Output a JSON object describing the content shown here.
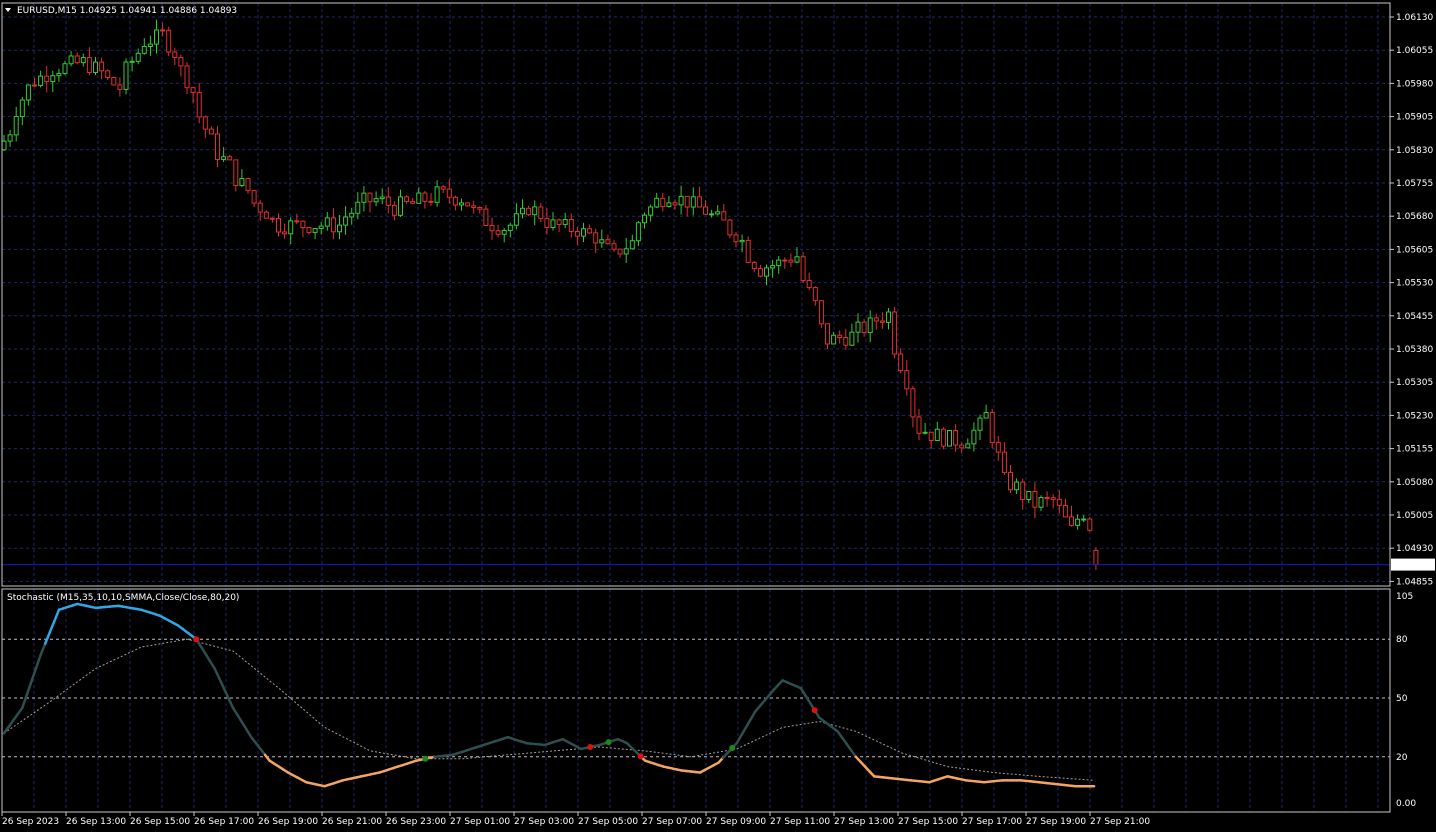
{
  "header": {
    "symbol_line": "EURUSD,M15  1.04925 1.04941 1.04886 1.04893",
    "dropdown_icon": "triangle-down-icon"
  },
  "indicator": {
    "label": "Stochastic (M15,35,10,10,SMMA,Close/Close,80,20)",
    "levels": [
      "80",
      "50",
      "20"
    ],
    "top_label": "105",
    "bottom_label": "0.00"
  },
  "price_axis": {
    "labels": [
      "1.06130",
      "1.06055",
      "1.05980",
      "1.05905",
      "1.05830",
      "1.05755",
      "1.05680",
      "1.05605",
      "1.05530",
      "1.05455",
      "1.05380",
      "1.05305",
      "1.05230",
      "1.05155",
      "1.05080",
      "1.05005",
      "1.04930",
      "1.04855"
    ],
    "current_price": "1.04893"
  },
  "time_axis": {
    "labels": [
      "26 Sep 2023",
      "26 Sep 13:00",
      "26 Sep 15:00",
      "26 Sep 17:00",
      "26 Sep 19:00",
      "26 Sep 21:00",
      "26 Sep 23:00",
      "27 Sep 01:00",
      "27 Sep 03:00",
      "27 Sep 05:00",
      "27 Sep 07:00",
      "27 Sep 09:00",
      "27 Sep 11:00",
      "27 Sep 13:00",
      "27 Sep 15:00",
      "27 Sep 17:00",
      "27 Sep 19:00",
      "27 Sep 21:00"
    ]
  },
  "colors": {
    "background": "#000000",
    "grid": "#1a2a66",
    "frame": "#c8c8c8",
    "bull": "#33cc33",
    "bear": "#e03030",
    "stoch_main": "#2f4f4f",
    "stoch_overbought": "#2ea8e8",
    "stoch_oversold": "#f4a460",
    "stoch_signal": "#a0a0a0",
    "price_line": "#1a1acc"
  },
  "chart_data": {
    "type": "candlestick",
    "symbol": "EURUSD",
    "timeframe": "M15",
    "last_bar": {
      "open": 1.04925,
      "high": 1.04941,
      "low": 1.04886,
      "close": 1.04893
    },
    "ylim": [
      1.04855,
      1.0613
    ],
    "close_path": [
      [
        0,
        1.0585
      ],
      [
        5,
        1.0597
      ],
      [
        10,
        1.0601
      ],
      [
        18,
        1.0603
      ],
      [
        25,
        1.0597
      ],
      [
        30,
        1.0607
      ],
      [
        35,
        1.0609
      ],
      [
        40,
        1.0599
      ],
      [
        45,
        1.0585
      ],
      [
        50,
        1.0578
      ],
      [
        55,
        1.0571
      ],
      [
        60,
        1.0566
      ],
      [
        65,
        1.0566
      ],
      [
        70,
        1.0566
      ],
      [
        73,
        1.0566
      ],
      [
        78,
        1.0571
      ],
      [
        82,
        1.0572
      ],
      [
        85,
        1.057
      ],
      [
        90,
        1.0571
      ],
      [
        95,
        1.0573
      ],
      [
        100,
        1.0572
      ],
      [
        105,
        1.0567
      ],
      [
        110,
        1.0565
      ],
      [
        115,
        1.057
      ],
      [
        120,
        1.0566
      ],
      [
        125,
        1.0565
      ],
      [
        130,
        1.0563
      ],
      [
        133,
        1.0559
      ],
      [
        137,
        1.0562
      ],
      [
        140,
        1.0569
      ],
      [
        145,
        1.0573
      ],
      [
        150,
        1.0571
      ],
      [
        155,
        1.0568
      ],
      [
        160,
        1.0564
      ],
      [
        165,
        1.0556
      ],
      [
        168,
        1.0557
      ],
      [
        173,
        1.0559
      ],
      [
        177,
        1.0548
      ],
      [
        180,
        1.054
      ],
      [
        185,
        1.0541
      ],
      [
        190,
        1.0544
      ],
      [
        193,
        1.0546
      ],
      [
        197,
        1.0531
      ],
      [
        200,
        1.052
      ],
      [
        205,
        1.0518
      ],
      [
        210,
        1.0517
      ],
      [
        215,
        1.0523
      ],
      [
        218,
        1.0509
      ],
      [
        222,
        1.0506
      ],
      [
        225,
        1.0503
      ],
      [
        230,
        1.0504
      ],
      [
        233,
        1.0497
      ],
      [
        236,
        1.0501
      ],
      [
        240,
        1.04893
      ]
    ],
    "bars": 240,
    "stochastic": {
      "params": "M15,35,10,10,SMMA,Close/Close,80,20",
      "levels": [
        80,
        50,
        20
      ],
      "ylim": [
        0,
        105
      ],
      "main": [
        [
          0,
          32
        ],
        [
          4,
          45
        ],
        [
          8,
          72
        ],
        [
          12,
          95
        ],
        [
          16,
          98
        ],
        [
          20,
          96
        ],
        [
          25,
          97
        ],
        [
          30,
          95
        ],
        [
          34,
          92
        ],
        [
          38,
          87
        ],
        [
          42,
          80
        ],
        [
          46,
          65
        ],
        [
          50,
          45
        ],
        [
          54,
          30
        ],
        [
          58,
          18
        ],
        [
          62,
          12
        ],
        [
          66,
          7
        ],
        [
          70,
          5
        ],
        [
          74,
          8
        ],
        [
          78,
          10
        ],
        [
          82,
          12
        ],
        [
          86,
          15
        ],
        [
          90,
          18
        ],
        [
          94,
          20
        ],
        [
          98,
          21
        ],
        [
          102,
          24
        ],
        [
          106,
          27
        ],
        [
          110,
          30
        ],
        [
          114,
          27
        ],
        [
          118,
          26
        ],
        [
          122,
          29
        ],
        [
          126,
          24
        ],
        [
          130,
          26
        ],
        [
          134,
          29
        ],
        [
          136,
          27
        ],
        [
          140,
          18
        ],
        [
          144,
          15
        ],
        [
          148,
          13
        ],
        [
          152,
          12
        ],
        [
          156,
          17
        ],
        [
          160,
          27
        ],
        [
          164,
          43
        ],
        [
          168,
          54
        ],
        [
          170,
          59
        ],
        [
          174,
          55
        ],
        [
          178,
          40
        ],
        [
          182,
          33
        ],
        [
          186,
          20
        ],
        [
          190,
          10
        ],
        [
          194,
          9
        ],
        [
          198,
          8
        ],
        [
          202,
          7
        ],
        [
          206,
          10
        ],
        [
          210,
          8
        ],
        [
          214,
          7
        ],
        [
          218,
          8
        ],
        [
          222,
          8
        ],
        [
          226,
          7
        ],
        [
          230,
          6
        ],
        [
          234,
          5
        ],
        [
          238,
          5
        ]
      ],
      "signal": [
        [
          0,
          32
        ],
        [
          10,
          48
        ],
        [
          20,
          65
        ],
        [
          30,
          76
        ],
        [
          40,
          80
        ],
        [
          50,
          74
        ],
        [
          60,
          55
        ],
        [
          70,
          35
        ],
        [
          80,
          23
        ],
        [
          90,
          19
        ],
        [
          100,
          19
        ],
        [
          110,
          21
        ],
        [
          120,
          23
        ],
        [
          130,
          25
        ],
        [
          140,
          23
        ],
        [
          150,
          20
        ],
        [
          160,
          24
        ],
        [
          170,
          35
        ],
        [
          178,
          38
        ],
        [
          186,
          33
        ],
        [
          196,
          22
        ],
        [
          206,
          15
        ],
        [
          216,
          12
        ],
        [
          226,
          10
        ],
        [
          238,
          8
        ]
      ],
      "cross_up": [
        92,
        132,
        159
      ],
      "cross_down": [
        42,
        128,
        139,
        177
      ]
    }
  }
}
